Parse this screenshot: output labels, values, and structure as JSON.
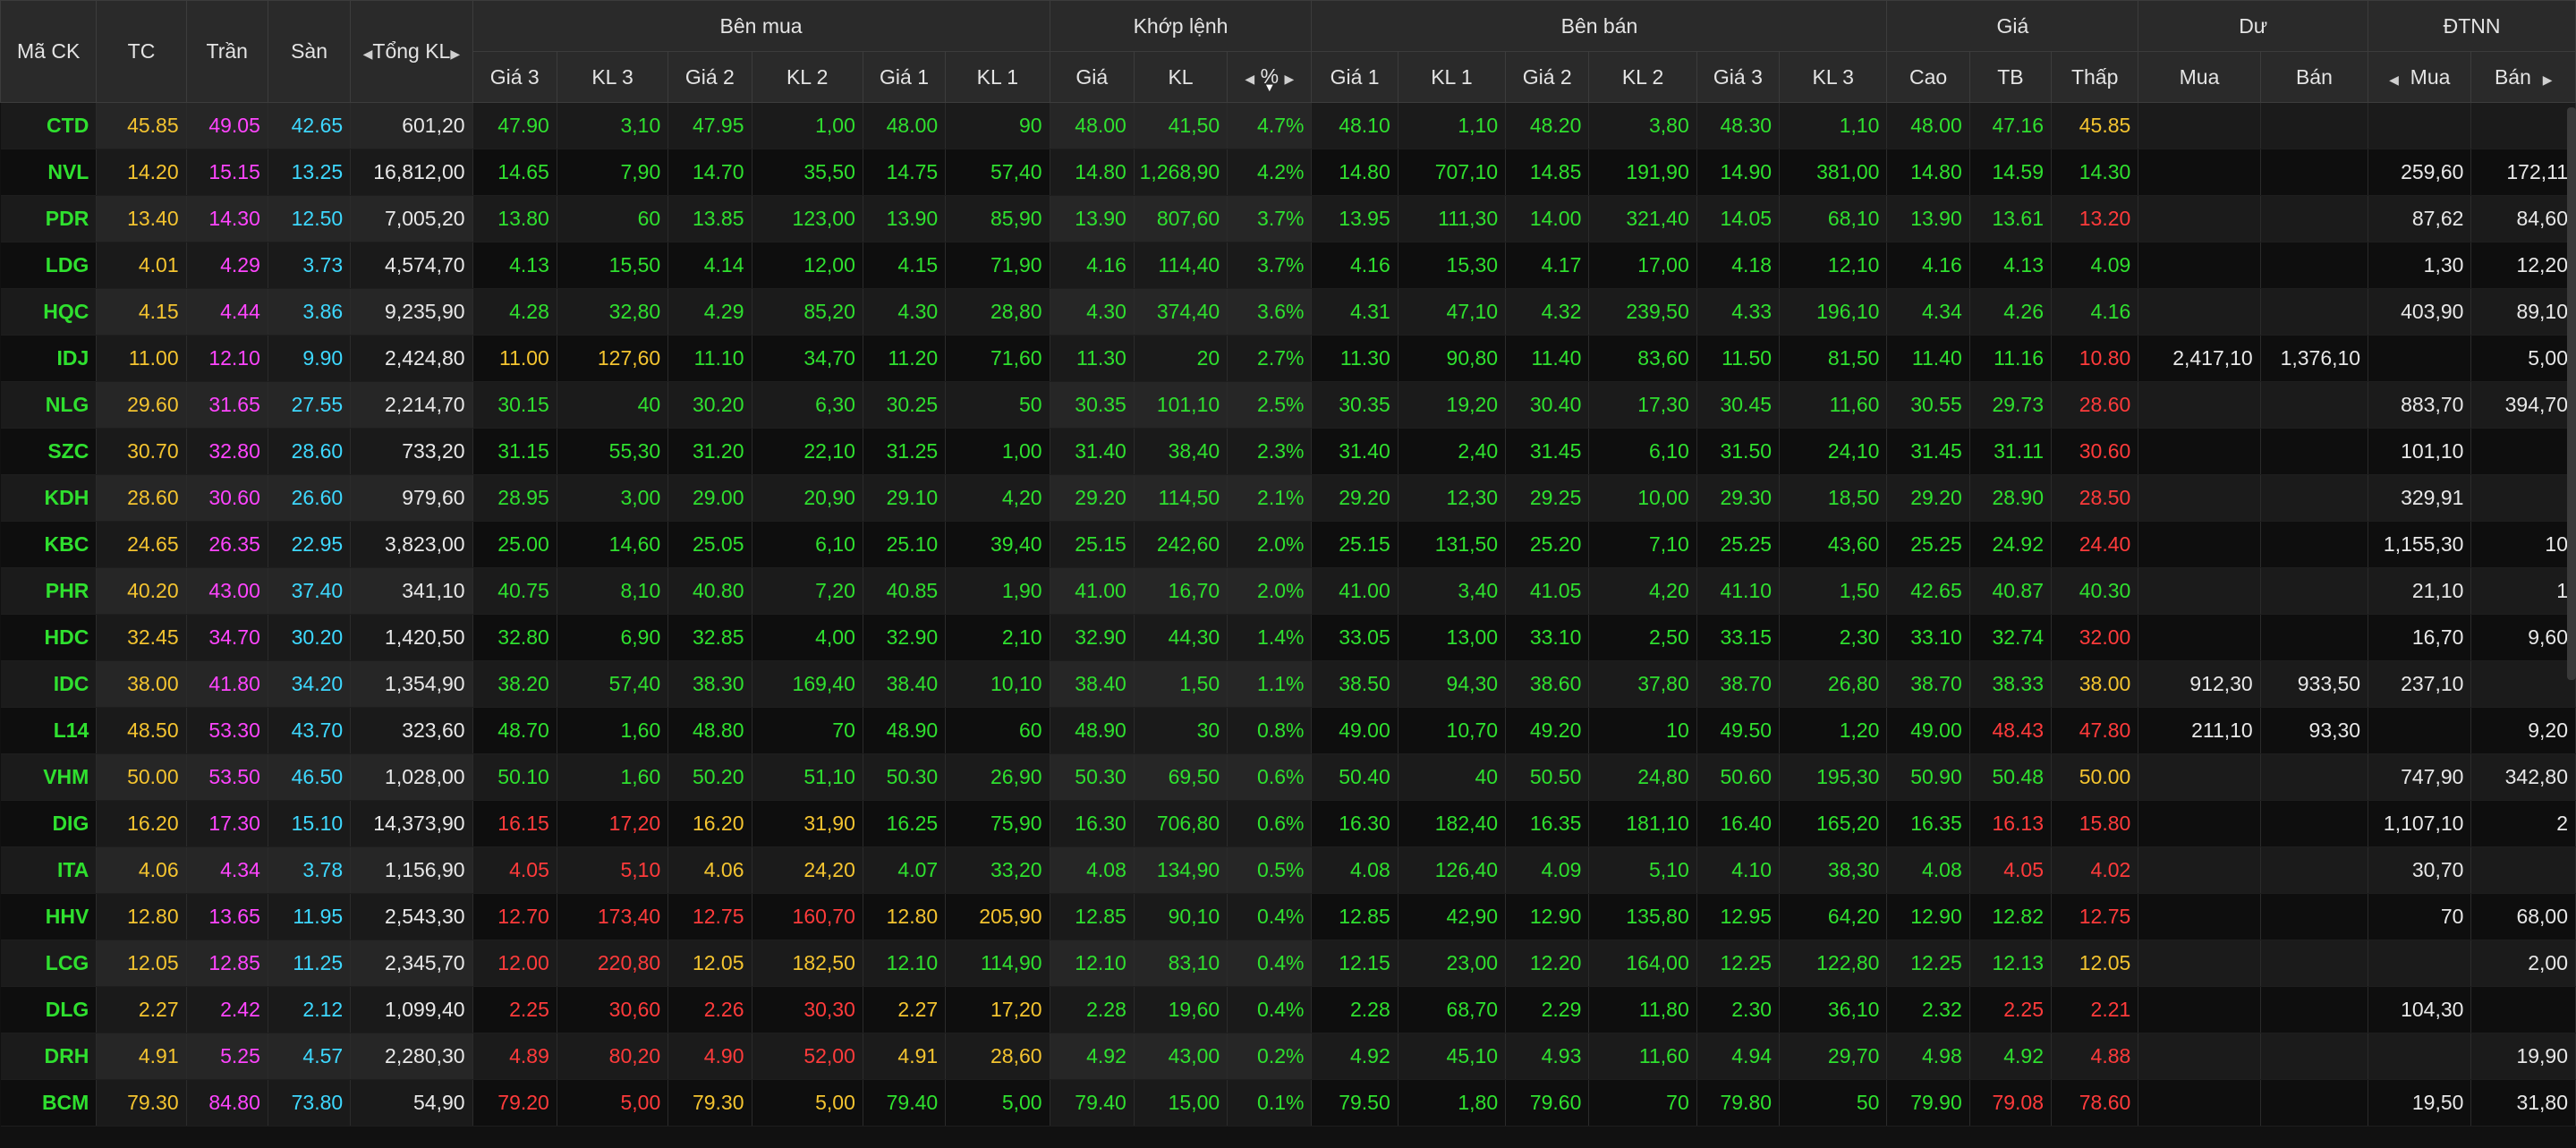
{
  "colors": {
    "up": "#2fe02f",
    "reference": "#f4c430",
    "ceiling": "#ff45ff",
    "floor": "#3ed8ff",
    "down": "#ff3b3b",
    "header_bg": "#2a2a2a"
  },
  "header": {
    "ma_ck": "Mã CK",
    "tc": "TC",
    "tran": "Trần",
    "san": "Sàn",
    "tong_kl": "Tổng KL",
    "ben_mua": "Bên mua",
    "khop_lenh": "Khớp lệnh",
    "ben_ban": "Bên bán",
    "gia": "Giá",
    "du": "Dư",
    "dtnn": "ĐTNN",
    "buy_cols": [
      "Giá 3",
      "KL 3",
      "Giá 2",
      "KL 2",
      "Giá 1",
      "KL 1"
    ],
    "match_cols": [
      "Giá",
      "KL",
      "%"
    ],
    "sell_cols": [
      "Giá 1",
      "KL 1",
      "Giá 2",
      "KL 2",
      "Giá 3",
      "KL 3"
    ],
    "price_cols": [
      "Cao",
      "TB",
      "Thấp"
    ],
    "du_cols": [
      "Mua",
      "Bán"
    ],
    "dtnn_cols": [
      "Mua",
      "Bán"
    ]
  },
  "rows": [
    {
      "sym": "CTD",
      "tc": "45.85",
      "tran": "49.05",
      "san": "42.65",
      "tot": "601,20",
      "b3": "47.90",
      "bk3": "3,10",
      "b2": "47.95",
      "bk2": "1,00",
      "b1": "48.00",
      "bk1": "90",
      "m": "48.00",
      "mk": "41,50",
      "pct": "4.7%",
      "s1": "48.10",
      "sk1": "1,10",
      "s2": "48.20",
      "sk2": "3,80",
      "s3": "48.30",
      "sk3": "1,10",
      "hi": "48.00",
      "avg": "47.16",
      "lo": "45.85",
      "dm": "",
      "db": "",
      "fm": "",
      "fb": "",
      "cl": {
        "b3": "up",
        "b2": "up",
        "b1": "up",
        "m": "up",
        "s1": "up",
        "s2": "up",
        "s3": "up",
        "hi": "up",
        "avg": "up",
        "lo": "ref"
      }
    },
    {
      "sym": "NVL",
      "tc": "14.20",
      "tran": "15.15",
      "san": "13.25",
      "tot": "16,812,00",
      "b3": "14.65",
      "bk3": "7,90",
      "b2": "14.70",
      "bk2": "35,50",
      "b1": "14.75",
      "bk1": "57,40",
      "m": "14.80",
      "mk": "1,268,90",
      "pct": "4.2%",
      "s1": "14.80",
      "sk1": "707,10",
      "s2": "14.85",
      "sk2": "191,90",
      "s3": "14.90",
      "sk3": "381,00",
      "hi": "14.80",
      "avg": "14.59",
      "lo": "14.30",
      "dm": "",
      "db": "",
      "fm": "259,60",
      "fb": "172,11",
      "cl": {
        "b3": "up",
        "b2": "up",
        "b1": "up",
        "m": "up",
        "s1": "up",
        "s2": "up",
        "s3": "up",
        "hi": "up",
        "avg": "up",
        "lo": "up"
      }
    },
    {
      "sym": "PDR",
      "tc": "13.40",
      "tran": "14.30",
      "san": "12.50",
      "tot": "7,005,20",
      "b3": "13.80",
      "bk3": "60",
      "b2": "13.85",
      "bk2": "123,00",
      "b1": "13.90",
      "bk1": "85,90",
      "m": "13.90",
      "mk": "807,60",
      "pct": "3.7%",
      "s1": "13.95",
      "sk1": "111,30",
      "s2": "14.00",
      "sk2": "321,40",
      "s3": "14.05",
      "sk3": "68,10",
      "hi": "13.90",
      "avg": "13.61",
      "lo": "13.20",
      "dm": "",
      "db": "",
      "fm": "87,62",
      "fb": "84,60",
      "cl": {
        "b3": "up",
        "b2": "up",
        "b1": "up",
        "m": "up",
        "s1": "up",
        "s2": "up",
        "s3": "up",
        "hi": "up",
        "avg": "up",
        "lo": "down"
      }
    },
    {
      "sym": "LDG",
      "tc": "4.01",
      "tran": "4.29",
      "san": "3.73",
      "tot": "4,574,70",
      "b3": "4.13",
      "bk3": "15,50",
      "b2": "4.14",
      "bk2": "12,00",
      "b1": "4.15",
      "bk1": "71,90",
      "m": "4.16",
      "mk": "114,40",
      "pct": "3.7%",
      "s1": "4.16",
      "sk1": "15,30",
      "s2": "4.17",
      "sk2": "17,00",
      "s3": "4.18",
      "sk3": "12,10",
      "hi": "4.16",
      "avg": "4.13",
      "lo": "4.09",
      "dm": "",
      "db": "",
      "fm": "1,30",
      "fb": "12,20",
      "cl": {
        "b3": "up",
        "b2": "up",
        "b1": "up",
        "m": "up",
        "s1": "up",
        "s2": "up",
        "s3": "up",
        "hi": "up",
        "avg": "up",
        "lo": "up"
      }
    },
    {
      "sym": "HQC",
      "tc": "4.15",
      "tran": "4.44",
      "san": "3.86",
      "tot": "9,235,90",
      "b3": "4.28",
      "bk3": "32,80",
      "b2": "4.29",
      "bk2": "85,20",
      "b1": "4.30",
      "bk1": "28,80",
      "m": "4.30",
      "mk": "374,40",
      "pct": "3.6%",
      "s1": "4.31",
      "sk1": "47,10",
      "s2": "4.32",
      "sk2": "239,50",
      "s3": "4.33",
      "sk3": "196,10",
      "hi": "4.34",
      "avg": "4.26",
      "lo": "4.16",
      "dm": "",
      "db": "",
      "fm": "403,90",
      "fb": "89,10",
      "cl": {
        "b3": "up",
        "b2": "up",
        "b1": "up",
        "m": "up",
        "s1": "up",
        "s2": "up",
        "s3": "up",
        "hi": "up",
        "avg": "up",
        "lo": "up"
      }
    },
    {
      "sym": "IDJ",
      "tc": "11.00",
      "tran": "12.10",
      "san": "9.90",
      "tot": "2,424,80",
      "b3": "11.00",
      "bk3": "127,60",
      "b2": "11.10",
      "bk2": "34,70",
      "b1": "11.20",
      "bk1": "71,60",
      "m": "11.30",
      "mk": "20",
      "pct": "2.7%",
      "s1": "11.30",
      "sk1": "90,80",
      "s2": "11.40",
      "sk2": "83,60",
      "s3": "11.50",
      "sk3": "81,50",
      "hi": "11.40",
      "avg": "11.16",
      "lo": "10.80",
      "dm": "2,417,10",
      "db": "1,376,10",
      "fm": "",
      "fb": "5,00",
      "cl": {
        "b3": "ref",
        "b2": "up",
        "b1": "up",
        "m": "up",
        "s1": "up",
        "s2": "up",
        "s3": "up",
        "hi": "up",
        "avg": "up",
        "lo": "down"
      }
    },
    {
      "sym": "NLG",
      "tc": "29.60",
      "tran": "31.65",
      "san": "27.55",
      "tot": "2,214,70",
      "b3": "30.15",
      "bk3": "40",
      "b2": "30.20",
      "bk2": "6,30",
      "b1": "30.25",
      "bk1": "50",
      "m": "30.35",
      "mk": "101,10",
      "pct": "2.5%",
      "s1": "30.35",
      "sk1": "19,20",
      "s2": "30.40",
      "sk2": "17,30",
      "s3": "30.45",
      "sk3": "11,60",
      "hi": "30.55",
      "avg": "29.73",
      "lo": "28.60",
      "dm": "",
      "db": "",
      "fm": "883,70",
      "fb": "394,70",
      "cl": {
        "b3": "up",
        "b2": "up",
        "b1": "up",
        "m": "up",
        "s1": "up",
        "s2": "up",
        "s3": "up",
        "hi": "up",
        "avg": "up",
        "lo": "down"
      }
    },
    {
      "sym": "SZC",
      "tc": "30.70",
      "tran": "32.80",
      "san": "28.60",
      "tot": "733,20",
      "b3": "31.15",
      "bk3": "55,30",
      "b2": "31.20",
      "bk2": "22,10",
      "b1": "31.25",
      "bk1": "1,00",
      "m": "31.40",
      "mk": "38,40",
      "pct": "2.3%",
      "s1": "31.40",
      "sk1": "2,40",
      "s2": "31.45",
      "sk2": "6,10",
      "s3": "31.50",
      "sk3": "24,10",
      "hi": "31.45",
      "avg": "31.11",
      "lo": "30.60",
      "dm": "",
      "db": "",
      "fm": "101,10",
      "fb": "",
      "cl": {
        "b3": "up",
        "b2": "up",
        "b1": "up",
        "m": "up",
        "s1": "up",
        "s2": "up",
        "s3": "up",
        "hi": "up",
        "avg": "up",
        "lo": "down"
      }
    },
    {
      "sym": "KDH",
      "tc": "28.60",
      "tran": "30.60",
      "san": "26.60",
      "tot": "979,60",
      "b3": "28.95",
      "bk3": "3,00",
      "b2": "29.00",
      "bk2": "20,90",
      "b1": "29.10",
      "bk1": "4,20",
      "m": "29.20",
      "mk": "114,50",
      "pct": "2.1%",
      "s1": "29.20",
      "sk1": "12,30",
      "s2": "29.25",
      "sk2": "10,00",
      "s3": "29.30",
      "sk3": "18,50",
      "hi": "29.20",
      "avg": "28.90",
      "lo": "28.50",
      "dm": "",
      "db": "",
      "fm": "329,91",
      "fb": "",
      "cl": {
        "b3": "up",
        "b2": "up",
        "b1": "up",
        "m": "up",
        "s1": "up",
        "s2": "up",
        "s3": "up",
        "hi": "up",
        "avg": "up",
        "lo": "down"
      }
    },
    {
      "sym": "KBC",
      "tc": "24.65",
      "tran": "26.35",
      "san": "22.95",
      "tot": "3,823,00",
      "b3": "25.00",
      "bk3": "14,60",
      "b2": "25.05",
      "bk2": "6,10",
      "b1": "25.10",
      "bk1": "39,40",
      "m": "25.15",
      "mk": "242,60",
      "pct": "2.0%",
      "s1": "25.15",
      "sk1": "131,50",
      "s2": "25.20",
      "sk2": "7,10",
      "s3": "25.25",
      "sk3": "43,60",
      "hi": "25.25",
      "avg": "24.92",
      "lo": "24.40",
      "dm": "",
      "db": "",
      "fm": "1,155,30",
      "fb": "10",
      "cl": {
        "b3": "up",
        "b2": "up",
        "b1": "up",
        "m": "up",
        "s1": "up",
        "s2": "up",
        "s3": "up",
        "hi": "up",
        "avg": "up",
        "lo": "down"
      }
    },
    {
      "sym": "PHR",
      "tc": "40.20",
      "tran": "43.00",
      "san": "37.40",
      "tot": "341,10",
      "b3": "40.75",
      "bk3": "8,10",
      "b2": "40.80",
      "bk2": "7,20",
      "b1": "40.85",
      "bk1": "1,90",
      "m": "41.00",
      "mk": "16,70",
      "pct": "2.0%",
      "s1": "41.00",
      "sk1": "3,40",
      "s2": "41.05",
      "sk2": "4,20",
      "s3": "41.10",
      "sk3": "1,50",
      "hi": "42.65",
      "avg": "40.87",
      "lo": "40.30",
      "dm": "",
      "db": "",
      "fm": "21,10",
      "fb": "1",
      "cl": {
        "b3": "up",
        "b2": "up",
        "b1": "up",
        "m": "up",
        "s1": "up",
        "s2": "up",
        "s3": "up",
        "hi": "up",
        "avg": "up",
        "lo": "up"
      }
    },
    {
      "sym": "HDC",
      "tc": "32.45",
      "tran": "34.70",
      "san": "30.20",
      "tot": "1,420,50",
      "b3": "32.80",
      "bk3": "6,90",
      "b2": "32.85",
      "bk2": "4,00",
      "b1": "32.90",
      "bk1": "2,10",
      "m": "32.90",
      "mk": "44,30",
      "pct": "1.4%",
      "s1": "33.05",
      "sk1": "13,00",
      "s2": "33.10",
      "sk2": "2,50",
      "s3": "33.15",
      "sk3": "2,30",
      "hi": "33.10",
      "avg": "32.74",
      "lo": "32.00",
      "dm": "",
      "db": "",
      "fm": "16,70",
      "fb": "9,60",
      "cl": {
        "b3": "up",
        "b2": "up",
        "b1": "up",
        "m": "up",
        "s1": "up",
        "s2": "up",
        "s3": "up",
        "hi": "up",
        "avg": "up",
        "lo": "down"
      }
    },
    {
      "sym": "IDC",
      "tc": "38.00",
      "tran": "41.80",
      "san": "34.20",
      "tot": "1,354,90",
      "b3": "38.20",
      "bk3": "57,40",
      "b2": "38.30",
      "bk2": "169,40",
      "b1": "38.40",
      "bk1": "10,10",
      "m": "38.40",
      "mk": "1,50",
      "pct": "1.1%",
      "s1": "38.50",
      "sk1": "94,30",
      "s2": "38.60",
      "sk2": "37,80",
      "s3": "38.70",
      "sk3": "26,80",
      "hi": "38.70",
      "avg": "38.33",
      "lo": "38.00",
      "dm": "912,30",
      "db": "933,50",
      "fm": "237,10",
      "fb": "",
      "cl": {
        "b3": "up",
        "b2": "up",
        "b1": "up",
        "m": "up",
        "s1": "up",
        "s2": "up",
        "s3": "up",
        "hi": "up",
        "avg": "up",
        "lo": "ref"
      }
    },
    {
      "sym": "L14",
      "tc": "48.50",
      "tran": "53.30",
      "san": "43.70",
      "tot": "323,60",
      "b3": "48.70",
      "bk3": "1,60",
      "b2": "48.80",
      "bk2": "70",
      "b1": "48.90",
      "bk1": "60",
      "m": "48.90",
      "mk": "30",
      "pct": "0.8%",
      "s1": "49.00",
      "sk1": "10,70",
      "s2": "49.20",
      "sk2": "10",
      "s3": "49.50",
      "sk3": "1,20",
      "hi": "49.00",
      "avg": "48.43",
      "lo": "47.80",
      "dm": "211,10",
      "db": "93,30",
      "fm": "",
      "fb": "9,20",
      "cl": {
        "b3": "up",
        "b2": "up",
        "b1": "up",
        "m": "up",
        "s1": "up",
        "s2": "up",
        "s3": "up",
        "hi": "up",
        "avg": "down",
        "lo": "down"
      }
    },
    {
      "sym": "VHM",
      "tc": "50.00",
      "tran": "53.50",
      "san": "46.50",
      "tot": "1,028,00",
      "b3": "50.10",
      "bk3": "1,60",
      "b2": "50.20",
      "bk2": "51,10",
      "b1": "50.30",
      "bk1": "26,90",
      "m": "50.30",
      "mk": "69,50",
      "pct": "0.6%",
      "s1": "50.40",
      "sk1": "40",
      "s2": "50.50",
      "sk2": "24,80",
      "s3": "50.60",
      "sk3": "195,30",
      "hi": "50.90",
      "avg": "50.48",
      "lo": "50.00",
      "dm": "",
      "db": "",
      "fm": "747,90",
      "fb": "342,80",
      "cl": {
        "b3": "up",
        "b2": "up",
        "b1": "up",
        "m": "up",
        "s1": "up",
        "s2": "up",
        "s3": "up",
        "hi": "up",
        "avg": "up",
        "lo": "ref"
      }
    },
    {
      "sym": "DIG",
      "tc": "16.20",
      "tran": "17.30",
      "san": "15.10",
      "tot": "14,373,90",
      "b3": "16.15",
      "bk3": "17,20",
      "b2": "16.20",
      "bk2": "31,90",
      "b1": "16.25",
      "bk1": "75,90",
      "m": "16.30",
      "mk": "706,80",
      "pct": "0.6%",
      "s1": "16.30",
      "sk1": "182,40",
      "s2": "16.35",
      "sk2": "181,10",
      "s3": "16.40",
      "sk3": "165,20",
      "hi": "16.35",
      "avg": "16.13",
      "lo": "15.80",
      "dm": "",
      "db": "",
      "fm": "1,107,10",
      "fb": "2",
      "cl": {
        "b3": "down",
        "b2": "ref",
        "b1": "up",
        "m": "up",
        "s1": "up",
        "s2": "up",
        "s3": "up",
        "hi": "up",
        "avg": "down",
        "lo": "down"
      }
    },
    {
      "sym": "ITA",
      "tc": "4.06",
      "tran": "4.34",
      "san": "3.78",
      "tot": "1,156,90",
      "b3": "4.05",
      "bk3": "5,10",
      "b2": "4.06",
      "bk2": "24,20",
      "b1": "4.07",
      "bk1": "33,20",
      "m": "4.08",
      "mk": "134,90",
      "pct": "0.5%",
      "s1": "4.08",
      "sk1": "126,40",
      "s2": "4.09",
      "sk2": "5,10",
      "s3": "4.10",
      "sk3": "38,30",
      "hi": "4.08",
      "avg": "4.05",
      "lo": "4.02",
      "dm": "",
      "db": "",
      "fm": "30,70",
      "fb": "",
      "cl": {
        "b3": "down",
        "b2": "ref",
        "b1": "up",
        "m": "up",
        "s1": "up",
        "s2": "up",
        "s3": "up",
        "hi": "up",
        "avg": "down",
        "lo": "down"
      }
    },
    {
      "sym": "HHV",
      "tc": "12.80",
      "tran": "13.65",
      "san": "11.95",
      "tot": "2,543,30",
      "b3": "12.70",
      "bk3": "173,40",
      "b2": "12.75",
      "bk2": "160,70",
      "b1": "12.80",
      "bk1": "205,90",
      "m": "12.85",
      "mk": "90,10",
      "pct": "0.4%",
      "s1": "12.85",
      "sk1": "42,90",
      "s2": "12.90",
      "sk2": "135,80",
      "s3": "12.95",
      "sk3": "64,20",
      "hi": "12.90",
      "avg": "12.82",
      "lo": "12.75",
      "dm": "",
      "db": "",
      "fm": "70",
      "fb": "68,00",
      "cl": {
        "b3": "down",
        "b2": "down",
        "b1": "ref",
        "m": "up",
        "s1": "up",
        "s2": "up",
        "s3": "up",
        "hi": "up",
        "avg": "up",
        "lo": "down"
      }
    },
    {
      "sym": "LCG",
      "tc": "12.05",
      "tran": "12.85",
      "san": "11.25",
      "tot": "2,345,70",
      "b3": "12.00",
      "bk3": "220,80",
      "b2": "12.05",
      "bk2": "182,50",
      "b1": "12.10",
      "bk1": "114,90",
      "m": "12.10",
      "mk": "83,10",
      "pct": "0.4%",
      "s1": "12.15",
      "sk1": "23,00",
      "s2": "12.20",
      "sk2": "164,00",
      "s3": "12.25",
      "sk3": "122,80",
      "hi": "12.25",
      "avg": "12.13",
      "lo": "12.05",
      "dm": "",
      "db": "",
      "fm": "",
      "fb": "2,00",
      "cl": {
        "b3": "down",
        "b2": "ref",
        "b1": "up",
        "m": "up",
        "s1": "up",
        "s2": "up",
        "s3": "up",
        "hi": "up",
        "avg": "up",
        "lo": "ref"
      }
    },
    {
      "sym": "DLG",
      "tc": "2.27",
      "tran": "2.42",
      "san": "2.12",
      "tot": "1,099,40",
      "b3": "2.25",
      "bk3": "30,60",
      "b2": "2.26",
      "bk2": "30,30",
      "b1": "2.27",
      "bk1": "17,20",
      "m": "2.28",
      "mk": "19,60",
      "pct": "0.4%",
      "s1": "2.28",
      "sk1": "68,70",
      "s2": "2.29",
      "sk2": "11,80",
      "s3": "2.30",
      "sk3": "36,10",
      "hi": "2.32",
      "avg": "2.25",
      "lo": "2.21",
      "dm": "",
      "db": "",
      "fm": "104,30",
      "fb": "",
      "cl": {
        "b3": "down",
        "b2": "down",
        "b1": "ref",
        "m": "up",
        "s1": "up",
        "s2": "up",
        "s3": "up",
        "hi": "up",
        "avg": "down",
        "lo": "down"
      }
    },
    {
      "sym": "DRH",
      "tc": "4.91",
      "tran": "5.25",
      "san": "4.57",
      "tot": "2,280,30",
      "b3": "4.89",
      "bk3": "80,20",
      "b2": "4.90",
      "bk2": "52,00",
      "b1": "4.91",
      "bk1": "28,60",
      "m": "4.92",
      "mk": "43,00",
      "pct": "0.2%",
      "s1": "4.92",
      "sk1": "45,10",
      "s2": "4.93",
      "sk2": "11,60",
      "s3": "4.94",
      "sk3": "29,70",
      "hi": "4.98",
      "avg": "4.92",
      "lo": "4.88",
      "dm": "",
      "db": "",
      "fm": "",
      "fb": "19,90",
      "cl": {
        "b3": "down",
        "b2": "down",
        "b1": "ref",
        "m": "up",
        "s1": "up",
        "s2": "up",
        "s3": "up",
        "hi": "up",
        "avg": "up",
        "lo": "down"
      }
    },
    {
      "sym": "BCM",
      "tc": "79.30",
      "tran": "84.80",
      "san": "73.80",
      "tot": "54,90",
      "b3": "79.20",
      "bk3": "5,00",
      "b2": "79.30",
      "bk2": "5,00",
      "b1": "79.40",
      "bk1": "5,00",
      "m": "79.40",
      "mk": "15,00",
      "pct": "0.1%",
      "s1": "79.50",
      "sk1": "1,80",
      "s2": "79.60",
      "sk2": "70",
      "s3": "79.80",
      "sk3": "50",
      "hi": "79.90",
      "avg": "79.08",
      "lo": "78.60",
      "dm": "",
      "db": "",
      "fm": "19,50",
      "fb": "31,80",
      "cl": {
        "b3": "down",
        "b2": "ref",
        "b1": "up",
        "m": "up",
        "s1": "up",
        "s2": "up",
        "s3": "up",
        "hi": "up",
        "avg": "down",
        "lo": "down"
      }
    }
  ]
}
